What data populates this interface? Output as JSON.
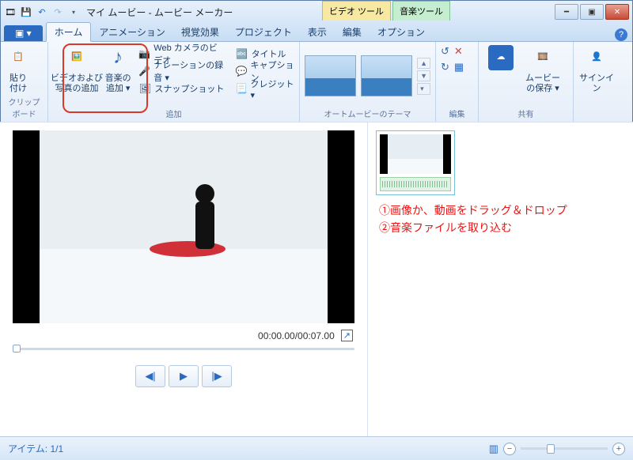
{
  "window": {
    "title": "マイ ムービー - ムービー メーカー"
  },
  "contextTools": {
    "video": "ビデオ ツール",
    "audio": "音楽ツール"
  },
  "tabs": {
    "file": "▣ ▾",
    "home": "ホーム",
    "animation": "アニメーション",
    "visualFx": "視覚効果",
    "project": "プロジェクト",
    "view": "表示",
    "edit": "編集",
    "options": "オプション"
  },
  "ribbon": {
    "clipboard": {
      "paste": "貼り\n付け",
      "label": "クリップボード"
    },
    "add": {
      "videoPhoto": "ビデオおよび\n写真の追加",
      "music": "音楽の\n追加 ▾",
      "webcam": "Web カメラのビデオ",
      "narration": "ナレーションの録音 ▾",
      "snapshot": "スナップショット",
      "titleBtn": "タイトル",
      "caption": "キャプション",
      "credits": "クレジット ▾",
      "label": "追加"
    },
    "autoMovie": {
      "label": "オートムービーのテーマ"
    },
    "edit": {
      "label": "編集"
    },
    "share": {
      "saveMovie": "ムービー\nの保存 ▾",
      "label": "共有"
    },
    "signin": "サインイン"
  },
  "preview": {
    "timecode": "00:00.00/00:07.00",
    "prev": "◀|",
    "play": "▶",
    "next": "|▶"
  },
  "notes": {
    "l1": "①画像か、動画をドラッグ＆ドロップ",
    "l2": "②音楽ファイルを取り込む"
  },
  "status": {
    "items": "アイテム: 1/1",
    "minus": "−",
    "plus": "+"
  }
}
